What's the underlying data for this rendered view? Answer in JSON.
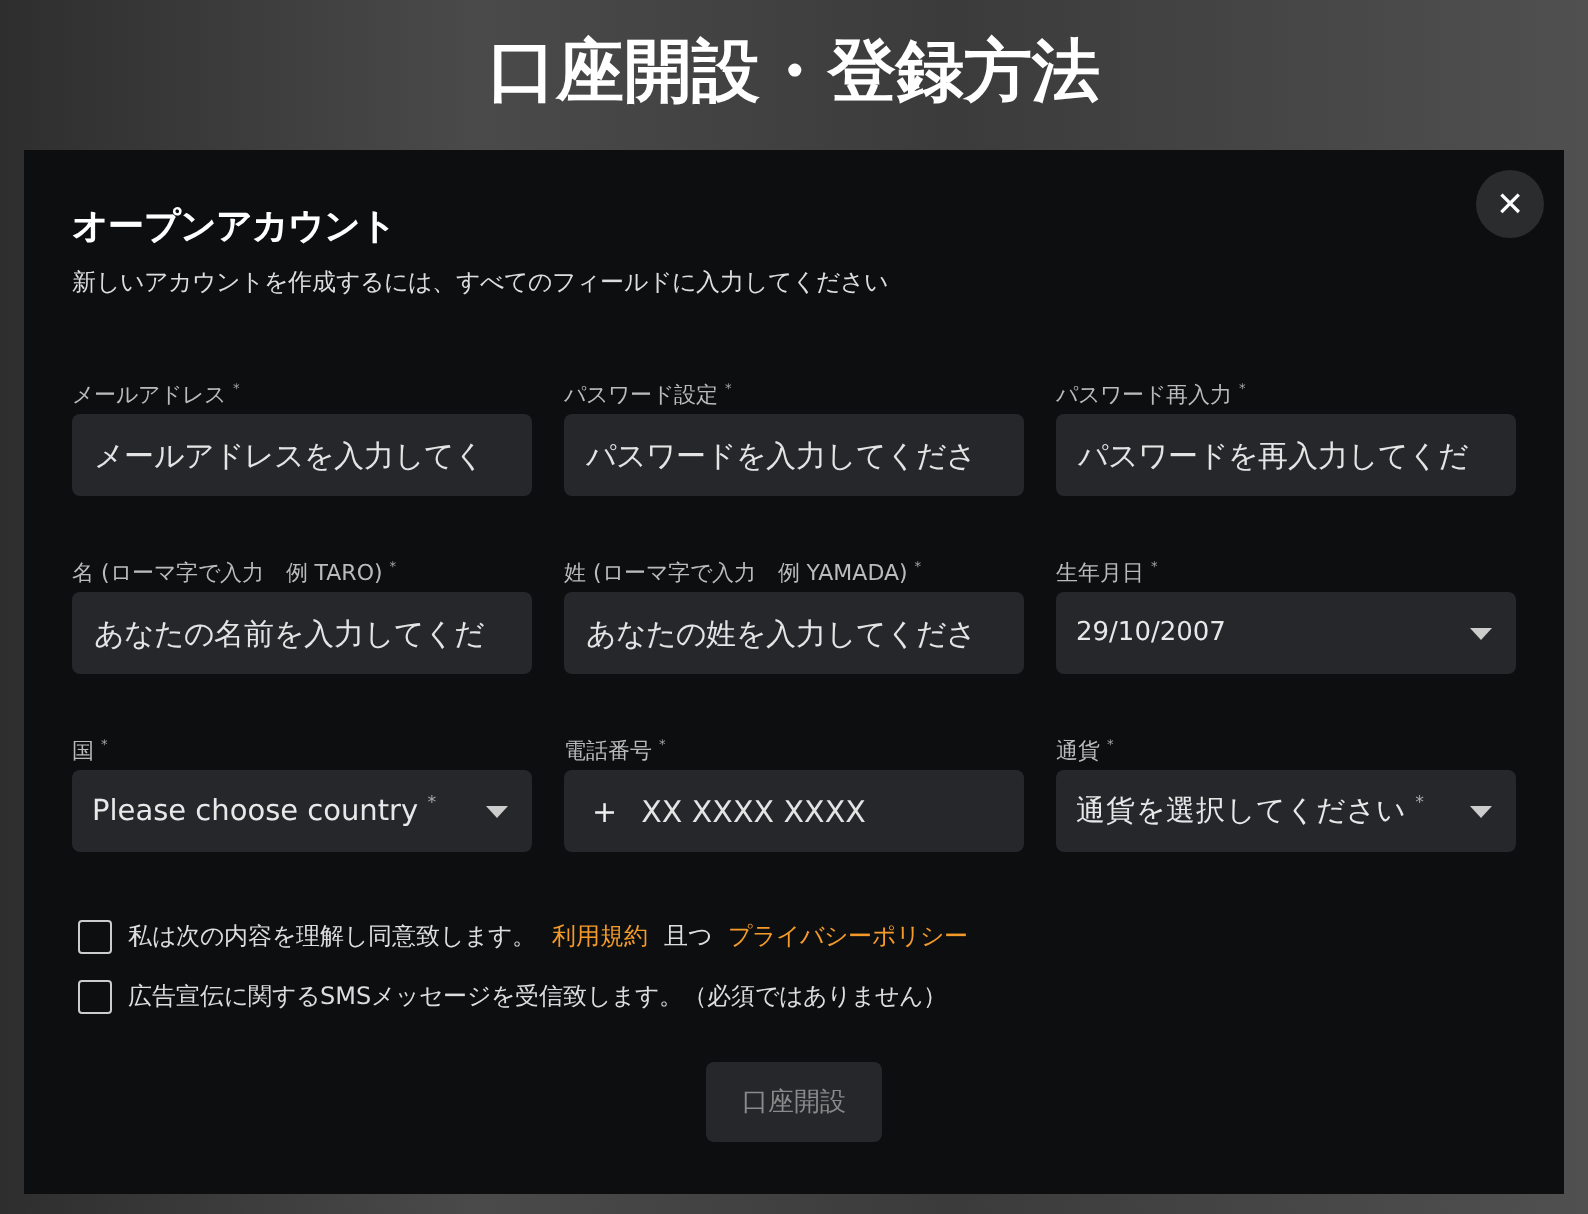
{
  "page_title": "口座開設・登録方法",
  "dialog": {
    "title": "オープンアカウント",
    "subtitle": "新しいアカウントを作成するには、すべてのフィールドに入力してください",
    "close": "×",
    "fields": [
      {
        "kind": "input",
        "label": "メールアドレス $^{*}$",
        "placeholder": "メールアドレスを入力してく"
      },
      {
        "kind": "input",
        "label": "パスワード設定 $^{*}$",
        "placeholder": "パスワードを入力してくださ"
      },
      {
        "kind": "input",
        "label": "パスワード再入力 $^{*}$",
        "placeholder": "パスワードを再入力してくだ"
      },
      {
        "kind": "input",
        "label": "名 (ローマ字で入力　例 TARO) $^{*}$",
        "placeholder": "あなたの名前を入力してくだ"
      },
      {
        "kind": "input",
        "label": "姓 (ローマ字で入力　例 YAMADA) $^{*}$",
        "placeholder": "あなたの姓を入力してくださ"
      },
      {
        "kind": "select",
        "label": "生年月日 $^{*}$",
        "value": "29/10/2007"
      },
      {
        "kind": "select",
        "label": "国 $^{*}$",
        "value": "Please choose country $^{*}$"
      },
      {
        "kind": "phone",
        "label": "電話番号 $^{*}$",
        "prefix": "+",
        "placeholder": "XX XXXX XXXX"
      },
      {
        "kind": "select",
        "label": "通貨 $^{*}$",
        "value": "通貨を選択してください $^{*}$"
      }
    ],
    "checkboxes": [
      {
        "checked": false,
        "parts": [
          {
            "kind": "text",
            "text": "私は次の内容を理解し同意致します。"
          },
          {
            "kind": "link",
            "text": "利用規約"
          },
          {
            "kind": "text",
            "text": "且つ"
          },
          {
            "kind": "link",
            "text": "プライバシーポリシー"
          }
        ]
      },
      {
        "checked": false,
        "parts": [
          {
            "kind": "text",
            "text": "広告宣伝に関するSMSメッセージを受信致します。（必須ではありません）"
          }
        ]
      }
    ],
    "submit": {
      "label": "口座開設",
      "disabled": true
    }
  }
}
